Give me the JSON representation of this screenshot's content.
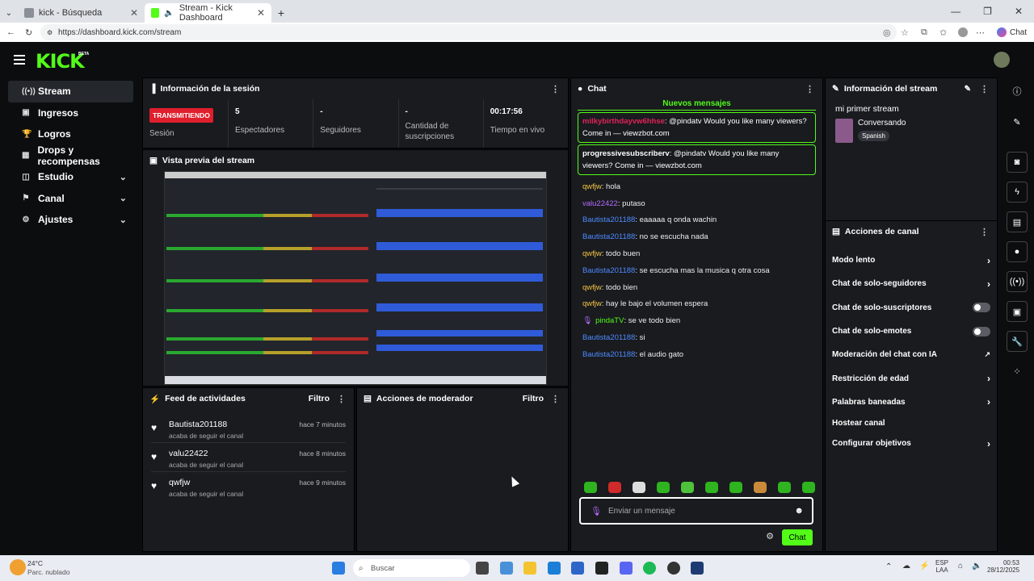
{
  "browser": {
    "tabs": [
      {
        "title": "kick - Búsqueda",
        "active": false,
        "favicon": "bing-icon",
        "color": "#8a8f98"
      },
      {
        "title": "Stream - Kick Dashboard",
        "active": true,
        "favicon": "kick-icon",
        "color": "#53fc18"
      }
    ],
    "new_tab": "+",
    "url": "https://dashboard.kick.com/stream",
    "chat_button": "Chat"
  },
  "app": {
    "logo": "KICK",
    "beta": "BETA",
    "accent": "#53fc18"
  },
  "sidebar": {
    "items": [
      {
        "label": "Stream",
        "icon": "broadcast-icon",
        "active": true,
        "expandable": false
      },
      {
        "label": "Ingresos",
        "icon": "revenue-icon",
        "active": false,
        "expandable": false
      },
      {
        "label": "Logros",
        "icon": "trophy-icon",
        "active": false,
        "expandable": false
      },
      {
        "label": "Drops y recompensas",
        "icon": "gift-icon",
        "active": false,
        "expandable": false
      },
      {
        "label": "Estudio",
        "icon": "studio-icon",
        "active": false,
        "expandable": true
      },
      {
        "label": "Canal",
        "icon": "flag-icon",
        "active": false,
        "expandable": true
      },
      {
        "label": "Ajustes",
        "icon": "gear-icon",
        "active": false,
        "expandable": true
      }
    ]
  },
  "session": {
    "title": "Información de la sesión",
    "live_badge": "TRANSMITIENDO",
    "session_label": "Sesión",
    "stats": [
      {
        "value": "5",
        "label": "Espectadores"
      },
      {
        "value": "-",
        "label": "Seguidores"
      },
      {
        "value": "-",
        "label": "Cantidad de suscripciones"
      },
      {
        "value": "00:17:56",
        "label": "Tiempo en vivo"
      }
    ]
  },
  "preview": {
    "title": "Vista previa del stream"
  },
  "feed": {
    "title": "Feed de actividades",
    "filter": "Filtro",
    "items": [
      {
        "name": "Bautista201188",
        "time": "hace 7 minutos",
        "desc": "acaba de seguir el canal"
      },
      {
        "name": "valu22422",
        "time": "hace 8 minutos",
        "desc": "acaba de seguir el canal"
      },
      {
        "name": "qwfjw",
        "time": "hace 9 minutos",
        "desc": "acaba de seguir el canal"
      }
    ]
  },
  "moderator": {
    "title": "Acciones de moderador",
    "filter": "Filtro"
  },
  "chat": {
    "title": "Chat",
    "new_messages": "Nuevos mensajes",
    "highlighted": [
      {
        "user": "milkybirthdayvw6hhse",
        "text": ": @pindatv Would you like many viewers? Come in — viewzbot.com",
        "color": "#e0235a"
      },
      {
        "user": "progressivesubscriberv",
        "text": ": @pindatv Would you like many viewers? Come in — viewzbot.com",
        "color": "#ffffff"
      }
    ],
    "messages": [
      {
        "user": "qwfjw",
        "text": ": hola",
        "color": "#f5c542"
      },
      {
        "user": "valu22422",
        "text": ": putaso",
        "color": "#b86bff"
      },
      {
        "user": "Bautista201188",
        "text": ": eaaaaa q onda wachin",
        "color": "#4f8bff"
      },
      {
        "user": "Bautista201188",
        "text": ": no se escucha nada",
        "color": "#4f8bff"
      },
      {
        "user": "qwfjw",
        "text": ": todo buen",
        "color": "#f5c542"
      },
      {
        "user": "Bautista201188",
        "text": ": se escucha mas la musica q otra cosa",
        "color": "#4f8bff"
      },
      {
        "user": "qwfjw",
        "text": ": todo bien",
        "color": "#f5c542"
      },
      {
        "user": "qwfjw",
        "text": ": hay le bajo el volumen espera",
        "color": "#f5c542"
      },
      {
        "user": "pindaTV",
        "text": ": se ve todo bien",
        "color": "#53fc18"
      },
      {
        "user": "Bautista201188",
        "text": ": si",
        "color": "#4f8bff"
      },
      {
        "user": "Bautista201188",
        "text": ": el audio gato",
        "color": "#4f8bff"
      }
    ],
    "input_placeholder": "Enviar un mensaje",
    "send_button": "Chat"
  },
  "stream_info": {
    "title": "Información del stream",
    "stream_title": "mi primer stream",
    "category": "Conversando",
    "language": "Spanish"
  },
  "channel_actions": {
    "title": "Acciones de canal",
    "items": [
      {
        "label": "Modo lento",
        "control": "arrow"
      },
      {
        "label": "Chat de solo-seguidores",
        "control": "arrow"
      },
      {
        "label": "Chat de solo-suscriptores",
        "control": "toggle"
      },
      {
        "label": "Chat de solo-emotes",
        "control": "toggle"
      },
      {
        "label": "Moderación del chat con IA",
        "control": "external"
      },
      {
        "label": "Restricción de edad",
        "control": "arrow"
      },
      {
        "label": "Palabras baneadas",
        "control": "arrow"
      },
      {
        "label": "Hostear canal",
        "control": "none"
      },
      {
        "label": "Configurar objetivos",
        "control": "arrow"
      }
    ]
  },
  "taskbar": {
    "weather_temp": "24°C",
    "weather_desc": "Parc. nublado",
    "search": "Buscar",
    "lang": "ESP",
    "lang2": "LAA",
    "time": "00:53",
    "date": "28/12/2025"
  }
}
